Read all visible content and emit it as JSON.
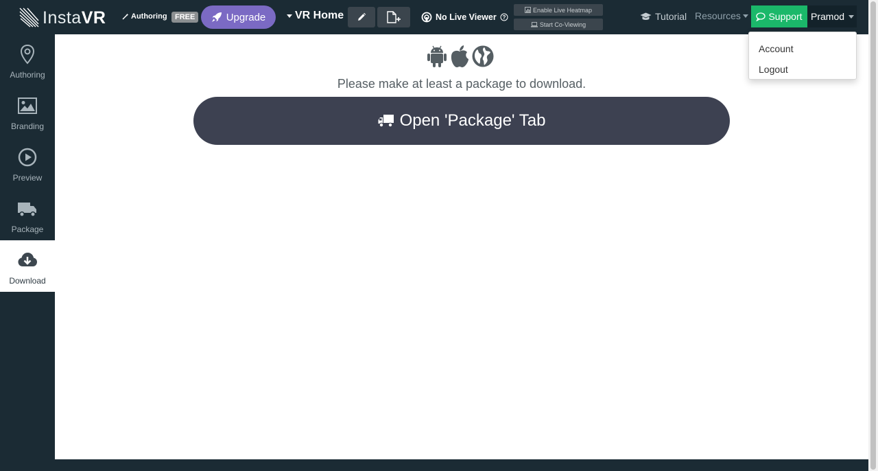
{
  "header": {
    "logo_light": "Insta",
    "logo_bold": "VR",
    "authoring_label": "Authoring",
    "free_badge": "FREE",
    "upgrade_label": "Upgrade",
    "project_name": "VR Home",
    "live_viewer_label": "No Live Viewer",
    "heatmap_label": "Enable Live Heatmap",
    "coview_label": "Start Co-Viewing",
    "tutorial_label": "Tutorial",
    "resources_label": "Resources",
    "support_label": "Support",
    "user_name": "Pramod"
  },
  "sidebar": {
    "items": [
      {
        "label": "Authoring",
        "icon": "map-pin-icon",
        "active": false
      },
      {
        "label": "Branding",
        "icon": "image-icon",
        "active": false
      },
      {
        "label": "Preview",
        "icon": "play-icon",
        "active": false
      },
      {
        "label": "Package",
        "icon": "truck-icon",
        "active": false
      },
      {
        "label": "Download",
        "icon": "cloud-download-icon",
        "active": true
      }
    ]
  },
  "main": {
    "platform_icons": [
      "android-icon",
      "apple-icon",
      "globe-icon"
    ],
    "message": "Please make at least a package to download.",
    "package_button_label": "Open 'Package' Tab"
  },
  "user_dropdown": {
    "items": [
      {
        "label": "Account"
      },
      {
        "label": "Logout"
      }
    ]
  },
  "colors": {
    "topbar_bg": "#1b2b34",
    "upgrade": "#7b6ac4",
    "support": "#1bb86a",
    "package_button": "#3d4151"
  }
}
